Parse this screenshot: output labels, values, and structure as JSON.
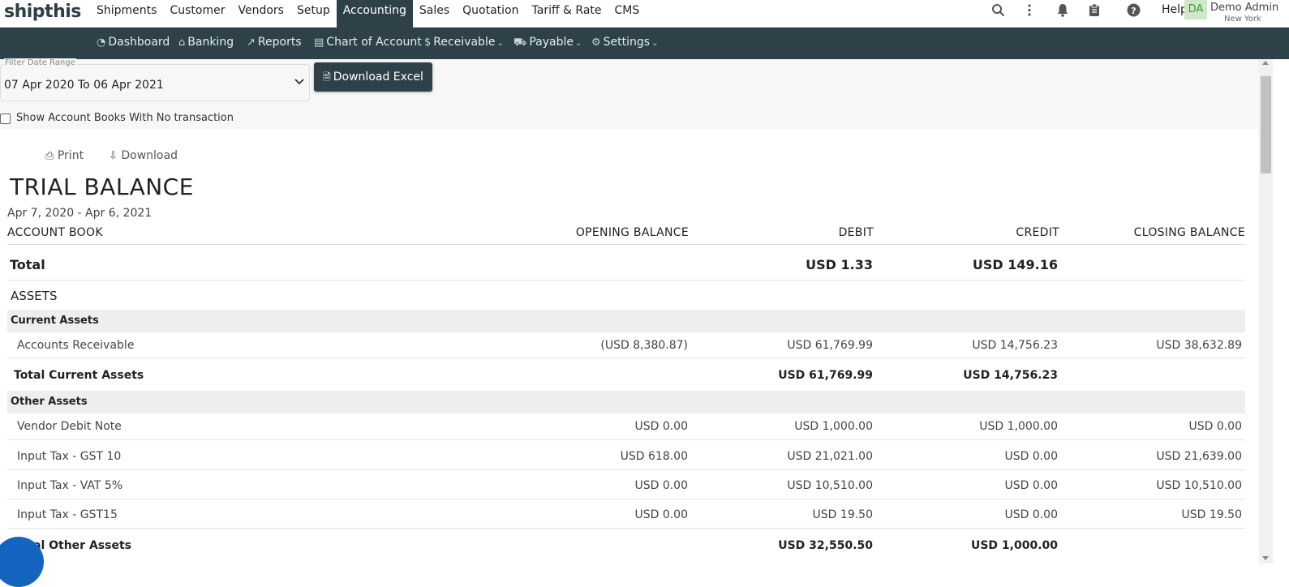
{
  "app": {
    "logo_text": "shipthis"
  },
  "main_nav": [
    {
      "label": "Shipments",
      "active": false
    },
    {
      "label": "Customer",
      "active": false
    },
    {
      "label": "Vendors",
      "active": false
    },
    {
      "label": "Setup",
      "active": false
    },
    {
      "label": "Accounting",
      "active": true
    },
    {
      "label": "Sales",
      "active": false
    },
    {
      "label": "Quotation",
      "active": false
    },
    {
      "label": "Tariff & Rate",
      "active": false
    },
    {
      "label": "CMS",
      "active": false
    }
  ],
  "top_right": {
    "help_label": "Help",
    "avatar_initials": "DA",
    "user_name": "Demo Admin",
    "user_location": "New York"
  },
  "sub_nav": [
    {
      "label": "Dashboard",
      "icon": "dashboard-icon"
    },
    {
      "label": "Banking",
      "icon": "bank-icon"
    },
    {
      "label": "Reports",
      "icon": "chart-icon"
    },
    {
      "label": "Chart of Account",
      "icon": "book-icon"
    },
    {
      "label": "Receivable",
      "icon": "dollar-icon"
    },
    {
      "label": "Payable",
      "icon": "cart-icon"
    },
    {
      "label": "Settings",
      "icon": "gear-icon"
    }
  ],
  "filter": {
    "legend": "Filter Date Range",
    "value": "07 Apr 2020 To 06 Apr 2021",
    "download_excel_label": "Download Excel",
    "checkbox_label": "Show Account Books With No transaction",
    "checkbox_checked": false
  },
  "report": {
    "print_label": "Print",
    "download_label": "Download",
    "title": "TRIAL BALANCE",
    "range": "Apr 7, 2020 - Apr 6, 2021",
    "columns": [
      "ACCOUNT BOOK",
      "OPENING BALANCE",
      "DEBIT",
      "CREDIT",
      "CLOSING BALANCE"
    ],
    "total": {
      "label": "Total",
      "opening": "",
      "debit": "USD 1.33",
      "credit": "USD 149.16",
      "closing": ""
    },
    "section_assets": "ASSETS",
    "current_assets": {
      "label": "Current Assets",
      "rows": [
        {
          "name": "Accounts Receivable",
          "opening": "(USD 8,380.87)",
          "debit": "USD 61,769.99",
          "credit": "USD 14,756.23",
          "closing": "USD 38,632.89"
        }
      ],
      "total": {
        "label": "Total Current Assets",
        "opening": "",
        "debit": "USD 61,769.99",
        "credit": "USD 14,756.23",
        "closing": ""
      }
    },
    "other_assets": {
      "label": "Other Assets",
      "rows": [
        {
          "name": "Vendor Debit Note",
          "opening": "USD 0.00",
          "debit": "USD 1,000.00",
          "credit": "USD 1,000.00",
          "closing": "USD 0.00"
        },
        {
          "name": "Input Tax - GST 10",
          "opening": "USD 618.00",
          "debit": "USD 21,021.00",
          "credit": "USD 0.00",
          "closing": "USD 21,639.00"
        },
        {
          "name": "Input Tax - VAT 5%",
          "opening": "USD 0.00",
          "debit": "USD 10,510.00",
          "credit": "USD 0.00",
          "closing": "USD 10,510.00"
        },
        {
          "name": "Input Tax - GST15",
          "opening": "USD 0.00",
          "debit": "USD 19.50",
          "credit": "USD 0.00",
          "closing": "USD 19.50"
        }
      ],
      "total": {
        "label": "Total Other Assets",
        "opening": "",
        "debit": "USD 32,550.50",
        "credit": "USD 1,000.00",
        "closing": ""
      }
    }
  }
}
